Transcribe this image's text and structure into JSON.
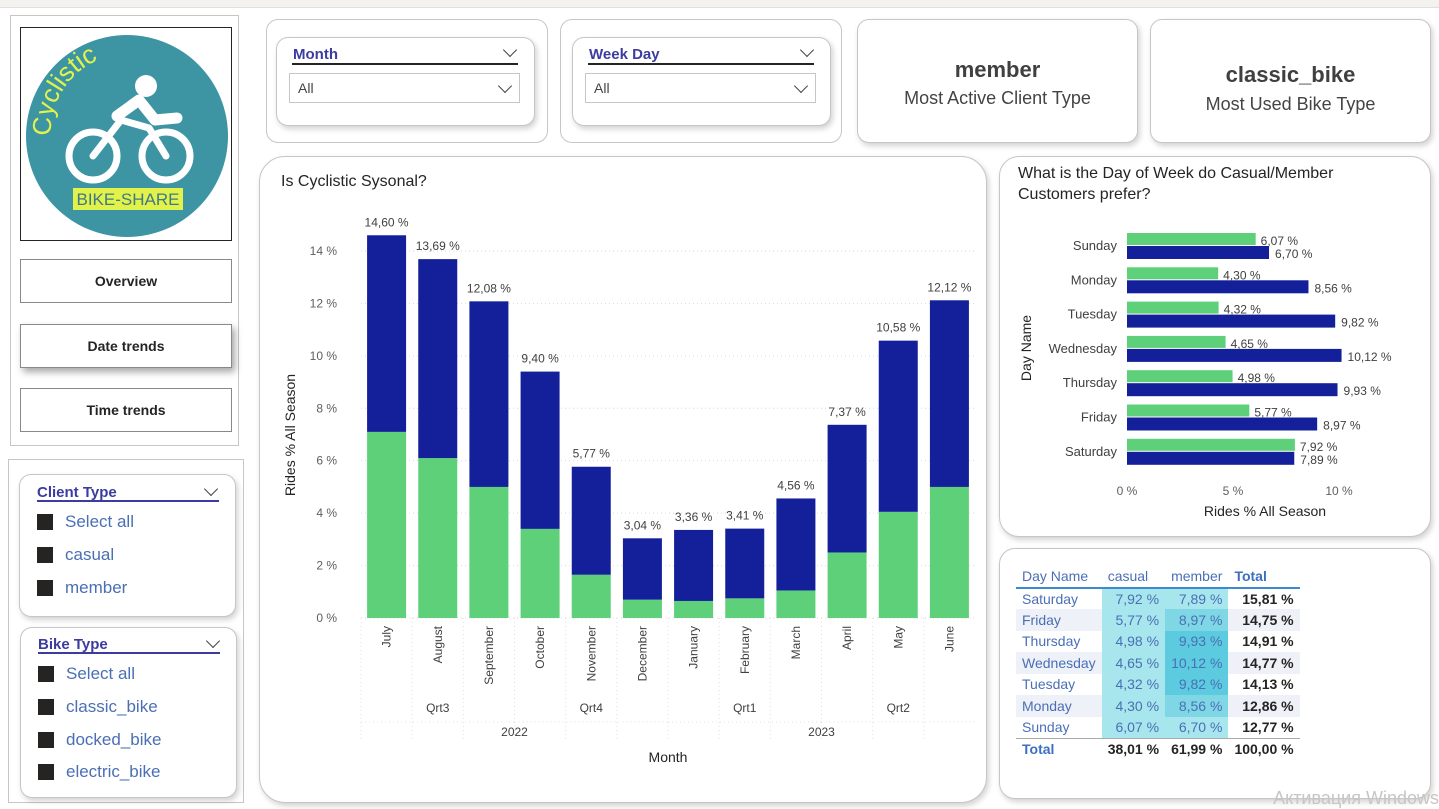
{
  "nav": {
    "overview": "Overview",
    "date_trends": "Date trends",
    "time_trends": "Time trends"
  },
  "logo": {
    "arc_text": "Cyclistic",
    "banner_text": "BIKE-SHARE",
    "colors": {
      "circle": "#3d95a3",
      "arc_text": "#e2f24a",
      "banner": "#e2f24a"
    }
  },
  "filters": {
    "month": {
      "title": "Month",
      "selected": "All"
    },
    "weekday": {
      "title": "Week Day",
      "selected": "All"
    }
  },
  "kpis": [
    {
      "value": "member",
      "label": "Most Active Client Type"
    },
    {
      "value": "classic_bike",
      "label": "Most Used Bike Type"
    }
  ],
  "slicers": {
    "client_type": {
      "title": "Client Type",
      "items": [
        "Select all",
        "casual",
        "member"
      ]
    },
    "bike_type": {
      "title": "Bike Type",
      "items": [
        "Select all",
        "classic_bike",
        "docked_bike",
        "electric_bike"
      ]
    }
  },
  "colors": {
    "casual": "#5ed07a",
    "member": "#13209a",
    "accent": "#3c3ca0",
    "matrix_light": "#a8e6ee",
    "matrix_mid": "#7fd7e6",
    "matrix_dark": "#5ccbdf"
  },
  "chart_data": [
    {
      "type": "bar",
      "title": "Is Cyclistic Sysonal?",
      "xlabel": "Month",
      "ylabel": "Rides % All Season",
      "categories": [
        "July",
        "August",
        "September",
        "October",
        "November",
        "December",
        "January",
        "February",
        "March",
        "April",
        "May",
        "June"
      ],
      "series": [
        {
          "values": [
            7.1,
            6.1,
            5.0,
            3.4,
            1.65,
            0.7,
            0.65,
            0.75,
            1.05,
            2.5,
            4.05,
            5.0
          ]
        },
        {
          "values": [
            7.5,
            7.59,
            7.08,
            6.0,
            4.12,
            2.34,
            2.71,
            2.66,
            3.51,
            4.87,
            6.53,
            7.12
          ]
        }
      ],
      "totals": [
        14.6,
        13.69,
        12.08,
        9.4,
        5.77,
        3.04,
        3.36,
        3.41,
        4.56,
        7.37,
        10.58,
        12.12
      ],
      "data_labels": [
        "14,60 %",
        "13,69 %",
        "12,08 %",
        "9,40 %",
        "5,77 %",
        "3,04 %",
        "3,36 %",
        "3,41 %",
        "4,56 %",
        "7,37 %",
        "10,58 %",
        "12,12 %"
      ],
      "y_ticks": [
        "0 %",
        "2 %",
        "4 %",
        "6 %",
        "8 %",
        "10 %",
        "12 %",
        "14 %"
      ],
      "ylim": [
        0,
        15
      ],
      "quarters": [
        "Qrt3",
        "Qrt4",
        "Qrt1",
        "Qrt2"
      ],
      "years": [
        "2022",
        "2023"
      ],
      "grid": true,
      "stacked": true
    },
    {
      "type": "bar",
      "orientation": "horizontal",
      "title": "What is the Day of Week do Casual/Member Customers prefer?",
      "xlabel": "Rides % All Season",
      "ylabel": "Day Name",
      "categories": [
        "Sunday",
        "Monday",
        "Tuesday",
        "Wednesday",
        "Thursday",
        "Friday",
        "Saturday"
      ],
      "series": [
        {
          "values": [
            6.07,
            4.3,
            4.32,
            4.65,
            4.98,
            5.77,
            7.92
          ],
          "labels": [
            "6,07 %",
            "4,30 %",
            "4,32 %",
            "4,65 %",
            "4,98 %",
            "5,77 %",
            "7,92 %"
          ]
        },
        {
          "values": [
            6.7,
            8.56,
            9.82,
            10.12,
            9.93,
            8.97,
            7.89
          ],
          "labels": [
            "6,70 %",
            "8,56 %",
            "9,82 %",
            "10,12 %",
            "9,93 %",
            "8,97 %",
            "7,89 %"
          ]
        }
      ],
      "x_ticks": [
        "0 %",
        "5 %",
        "10 %"
      ],
      "xlim": [
        0,
        10.5
      ]
    }
  ],
  "matrix": {
    "headers": [
      "Day Name",
      "casual",
      "member",
      "Total"
    ],
    "rows": [
      {
        "day": "Saturday",
        "casual": "7,92 %",
        "member": "7,89 %",
        "total": "15,81 %",
        "cv": 7.92,
        "mv": 7.89
      },
      {
        "day": "Friday",
        "casual": "5,77 %",
        "member": "8,97 %",
        "total": "14,75 %",
        "cv": 5.77,
        "mv": 8.97
      },
      {
        "day": "Thursday",
        "casual": "4,98 %",
        "member": "9,93 %",
        "total": "14,91 %",
        "cv": 4.98,
        "mv": 9.93
      },
      {
        "day": "Wednesday",
        "casual": "4,65 %",
        "member": "10,12 %",
        "total": "14,77 %",
        "cv": 4.65,
        "mv": 10.12
      },
      {
        "day": "Tuesday",
        "casual": "4,32 %",
        "member": "9,82 %",
        "total": "14,13 %",
        "cv": 4.32,
        "mv": 9.82
      },
      {
        "day": "Monday",
        "casual": "4,30 %",
        "member": "8,56 %",
        "total": "12,86 %",
        "cv": 4.3,
        "mv": 8.56
      },
      {
        "day": "Sunday",
        "casual": "6,07 %",
        "member": "6,70 %",
        "total": "12,77 %",
        "cv": 6.07,
        "mv": 6.7
      }
    ],
    "total": {
      "day": "Total",
      "casual": "38,01 %",
      "member": "61,99 %",
      "total": "100,00 %"
    }
  },
  "watermark": "Активация Windows"
}
